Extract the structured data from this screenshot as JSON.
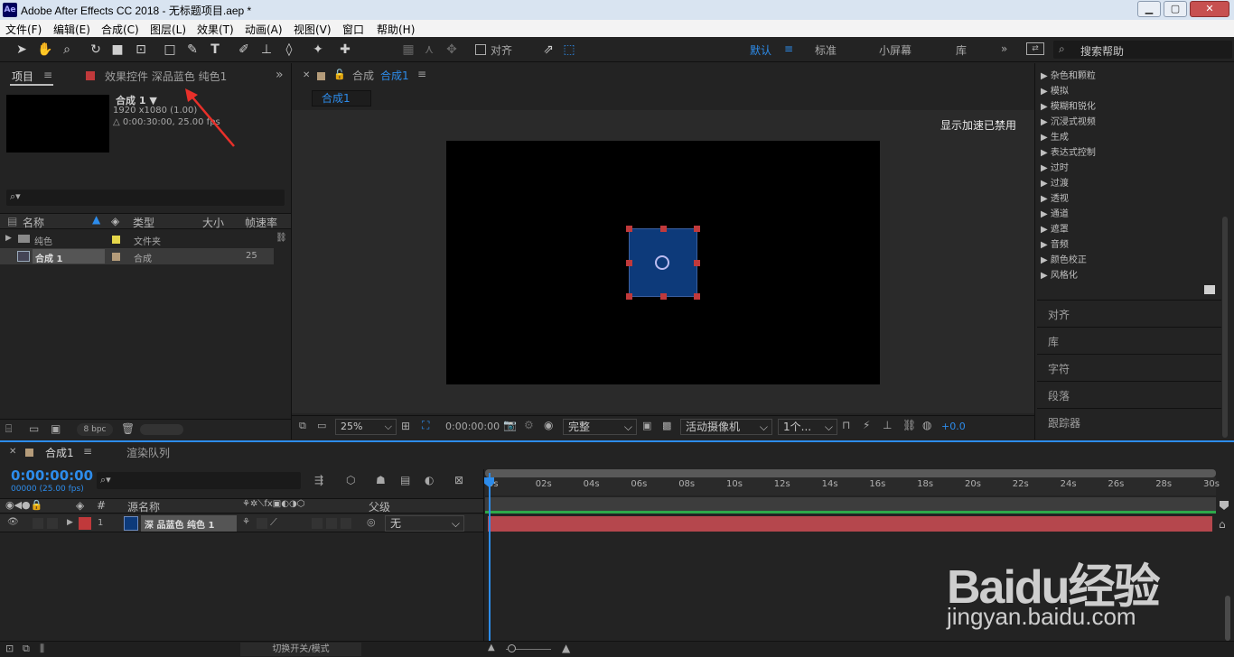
{
  "window": {
    "title": "Adobe After Effects CC 2018 - 无标题项目.aep *",
    "logo": "Ae",
    "min": "▁",
    "max": "▢",
    "close": "✕"
  },
  "menu": [
    "文件(F)",
    "编辑(E)",
    "合成(C)",
    "图层(L)",
    "效果(T)",
    "动画(A)",
    "视图(V)",
    "窗口",
    "帮助(H)"
  ],
  "toolbar": {
    "snap_label": "对齐",
    "workspaces": [
      "默认",
      "标准",
      "小屏幕",
      "库"
    ],
    "search_placeholder": "搜索帮助"
  },
  "project": {
    "tab": "项目",
    "effects_tab": "效果控件 深品蓝色 纯色1",
    "comp_name": "合成 1 ▼",
    "comp_size": "1920 x1080 (1.00)",
    "comp_dur": "△ 0:00:30:00, 25.00 fps",
    "cols": [
      "名称",
      "类型",
      "大小",
      "帧速率"
    ],
    "rows": [
      {
        "name": "纯色",
        "type": "文件夹",
        "rate": ""
      },
      {
        "name": "合成 1",
        "type": "合成",
        "rate": "25"
      }
    ],
    "bpc": "8 bpc"
  },
  "viewer": {
    "tab": "合成",
    "tab_active": "合成1",
    "sub_tab": "合成1",
    "notice": "显示加速已禁用",
    "zoom": "25%",
    "timecode": "0:00:00:00",
    "resolution": "完整",
    "camera": "活动摄像机",
    "views": "1个...",
    "exposure": "+0.0"
  },
  "effects": [
    "杂色和颗粒",
    "模拟",
    "模糊和锐化",
    "沉浸式视频",
    "生成",
    "表达式控制",
    "过时",
    "过渡",
    "透视",
    "通道",
    "遮罩",
    "音频",
    "颜色校正",
    "风格化"
  ],
  "side_panels": [
    "对齐",
    "库",
    "字符",
    "段落",
    "跟踪器"
  ],
  "timeline": {
    "tab": "合成1",
    "render_tab": "渲染队列",
    "timecode": "0:00:00:00",
    "frames": "00000 (25.00 fps)",
    "cols": {
      "num": "#",
      "source": "源名称",
      "parent": "父级"
    },
    "layer": {
      "num": "1",
      "name": "深 品蓝色 纯色 1",
      "parent": "无"
    },
    "ruler": [
      "0s",
      "02s",
      "04s",
      "06s",
      "08s",
      "10s",
      "12s",
      "14s",
      "16s",
      "18s",
      "20s",
      "22s",
      "24s",
      "26s",
      "28s",
      "30s"
    ],
    "footer": "切换开关/模式"
  },
  "colors": {
    "accent": "#2d8ceb",
    "solid": "#0d3a7a",
    "layer_bar": "#b5474d",
    "handle": "#c0393b"
  },
  "watermark": {
    "brand": "Baidu经验",
    "url": "jingyan.baidu.com"
  }
}
